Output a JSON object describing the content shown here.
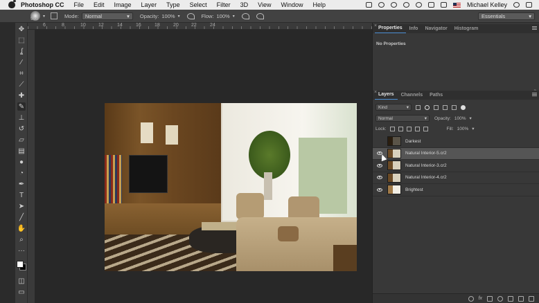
{
  "menubar": {
    "app_name": "Photoshop CC",
    "items": [
      "File",
      "Edit",
      "Image",
      "Layer",
      "Type",
      "Select",
      "Filter",
      "3D",
      "View",
      "Window",
      "Help"
    ],
    "user": "Michael Kelley"
  },
  "options_bar": {
    "brush_size": "900",
    "mode_label": "Mode:",
    "mode_value": "Normal",
    "opacity_label": "Opacity:",
    "opacity_value": "100%",
    "flow_label": "Flow:",
    "flow_value": "100%",
    "workspace": "Essentials"
  },
  "ruler": {
    "labels": [
      "6",
      "8",
      "10",
      "12",
      "14",
      "16",
      "18",
      "20",
      "22",
      "24"
    ]
  },
  "properties_panel": {
    "tabs": [
      "Properties",
      "Info",
      "Navigator",
      "Histogram"
    ],
    "message": "No Properties"
  },
  "layers_panel": {
    "tabs": [
      "Layers",
      "Channels",
      "Paths"
    ],
    "filter_kind": "Kind",
    "blend_mode": "Normal",
    "opacity_label": "Opacity:",
    "opacity_value": "100%",
    "lock_label": "Lock:",
    "fill_label": "Fill:",
    "fill_value": "100%",
    "layers": [
      {
        "name": "Darkest",
        "visible": false,
        "selected": false
      },
      {
        "name": "Natural Interior-5.cr2",
        "visible": true,
        "selected": true
      },
      {
        "name": "Natural Interior-3.cr2",
        "visible": true,
        "selected": false
      },
      {
        "name": "Natural Interior-4.cr2",
        "visible": true,
        "selected": false
      },
      {
        "name": "Brightest",
        "visible": true,
        "selected": false
      }
    ]
  }
}
